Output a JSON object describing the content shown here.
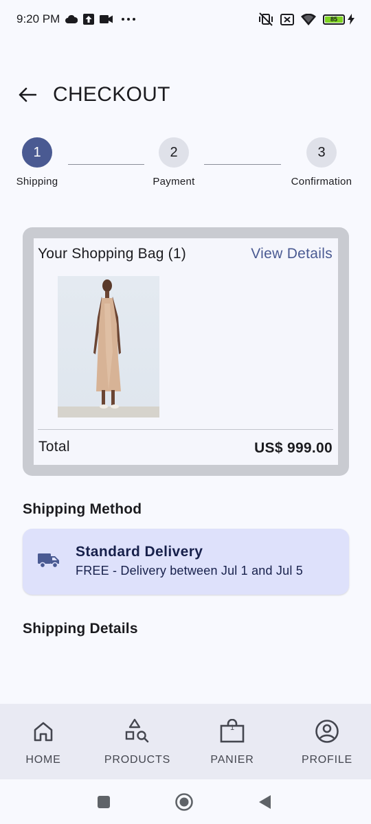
{
  "status_bar": {
    "time": "9:20 PM",
    "battery_level": "85",
    "icons": [
      "cloud-icon",
      "upload-icon",
      "video-icon",
      "more-dots-icon",
      "vibrate-off-icon",
      "no-sim-icon",
      "wifi-icon",
      "battery-icon",
      "charging-icon"
    ]
  },
  "header": {
    "title": "CHECKOUT",
    "back_icon": "arrow-back-icon"
  },
  "stepper": {
    "current_step": 1,
    "steps": [
      {
        "number": "1",
        "label": "Shipping"
      },
      {
        "number": "2",
        "label": "Payment"
      },
      {
        "number": "3",
        "label": "Confirmation"
      }
    ]
  },
  "bag": {
    "title": "Your Shopping Bag (1)",
    "view_details": "View Details",
    "total_label": "Total",
    "total_value": "US$ 999.00",
    "item_image": "dress-product-image"
  },
  "shipping_method": {
    "section_title": "Shipping Method",
    "option_title": "Standard Delivery",
    "option_subtitle": "FREE - Delivery between Jul 1 and Jul 5",
    "icon": "truck-icon"
  },
  "shipping_details": {
    "section_title": "Shipping Details"
  },
  "bottom_nav": {
    "items": [
      {
        "label": "HOME",
        "icon": "home-icon"
      },
      {
        "label": "PRODUCTS",
        "icon": "shapes-search-icon"
      },
      {
        "label": "PANIER",
        "icon": "shopping-bag-icon",
        "badge": "1"
      },
      {
        "label": "PROFILE",
        "icon": "account-circle-icon"
      }
    ]
  },
  "system_nav": {
    "icons": [
      "recents-square-icon",
      "home-circle-icon",
      "back-triangle-icon"
    ]
  },
  "colors": {
    "accent": "#4a5a92",
    "background": "#f8f9fe",
    "card_highlight": "#dee1fb",
    "nav_background": "#e9eaf3"
  }
}
